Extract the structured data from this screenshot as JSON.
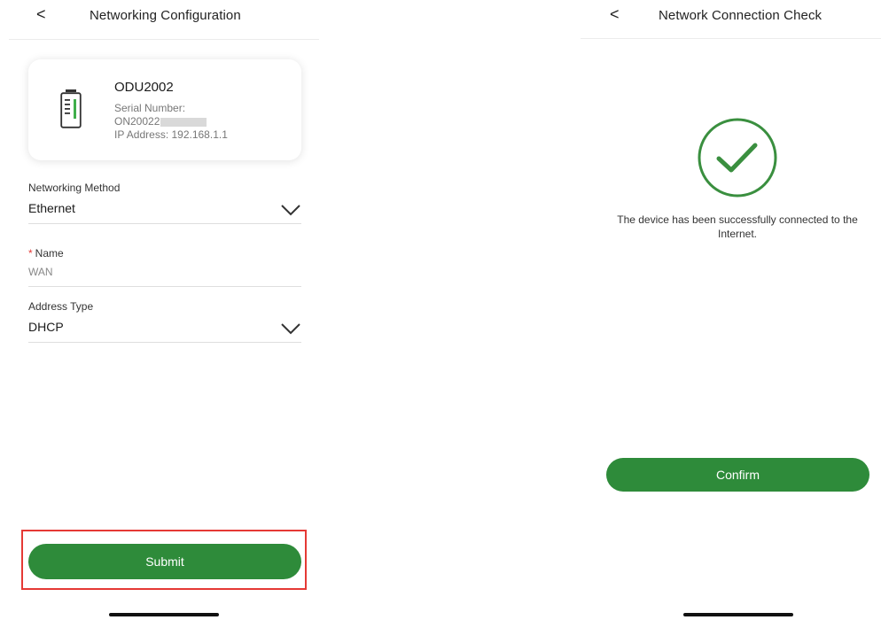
{
  "left_screen": {
    "header": {
      "back_glyph": "<",
      "title": "Networking Configuration"
    },
    "device": {
      "icon": "battery-device-icon",
      "name": "ODU2002",
      "serial_label": "Serial Number:",
      "serial_value": "ON20022",
      "ip": "IP Address: 192.168.1.1"
    },
    "fields": {
      "method": {
        "label": "Networking Method",
        "value": "Ethernet"
      },
      "name": {
        "required_mark": "*",
        "label": "Name",
        "value": "WAN"
      },
      "address": {
        "label": "Address Type",
        "value": "DHCP"
      }
    },
    "submit_label": "Submit"
  },
  "right_screen": {
    "header": {
      "back_glyph": "<",
      "title": "Network Connection Check"
    },
    "status_icon": "check-circle-icon",
    "message": "The device has been successfully connected to the Internet.",
    "confirm_label": "Confirm"
  },
  "colors": {
    "accent_green": "#2e8b3a",
    "highlight_red": "#e53935"
  }
}
